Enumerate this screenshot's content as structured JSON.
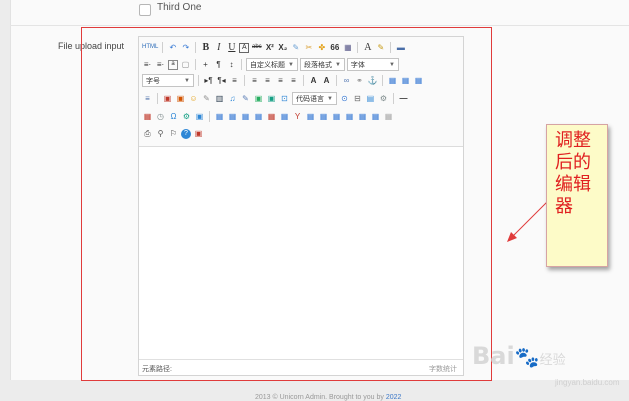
{
  "form": {
    "checkbox_label": "Third One",
    "file_upload_label": "File upload input"
  },
  "editor": {
    "row1": [
      "HTML",
      "↶",
      "↷",
      "B",
      "I",
      "U",
      "A",
      "abc",
      "X²",
      "X₂",
      "✎",
      "✂",
      "✤",
      "66",
      "▦",
      "A",
      "✎",
      "▬"
    ],
    "row2_lists": [
      "≡·",
      "≡·",
      "a",
      "▢",
      "+",
      "¶",
      "↕"
    ],
    "dropdowns": {
      "custom_title": "自定义标题",
      "paragraph_format": "段落格式",
      "font_family": "字体",
      "font_size": "字号",
      "code_language": "代码语言"
    },
    "row3": [
      "▸¶",
      "¶◂",
      "≡",
      "≡",
      "≡",
      "≡",
      "≡",
      "A",
      "A",
      "∞",
      "⚭",
      "⚓",
      "▦",
      "▦",
      "▦"
    ],
    "row4": [
      "≡",
      "▣",
      "▣",
      "☺",
      "✎",
      "▥",
      "♫",
      "✎",
      "▣",
      "▣",
      "⊡",
      "⊙",
      "⊟",
      "▤",
      "⚙",
      "—"
    ],
    "row5": [
      "▦",
      "◷",
      "Ω",
      "⚙",
      "▣",
      "▦",
      "▦",
      "▦",
      "▦",
      "▦",
      "▦",
      "Y",
      "▦",
      "▦",
      "▦",
      "▦",
      "▦",
      "▦",
      "▦"
    ],
    "row6": [
      "⎙",
      "⚲",
      "⚐",
      "?",
      "▣"
    ],
    "status_path_label": "元素路径:",
    "word_count_label": "字数统计"
  },
  "annotation": {
    "callout_lines": [
      "调整",
      "后的",
      "编辑",
      "器"
    ],
    "box_color": "#e03b3b",
    "callout_bg": "#fdfbc8",
    "callout_text_color": "#e02020"
  },
  "footer": {
    "text": "2013 © Unicorn Admin. Brought to you by",
    "link": "2022"
  },
  "watermark": {
    "brand": "Bai",
    "brand_suffix": "经验",
    "sub": "jingyan.baidu.com"
  }
}
